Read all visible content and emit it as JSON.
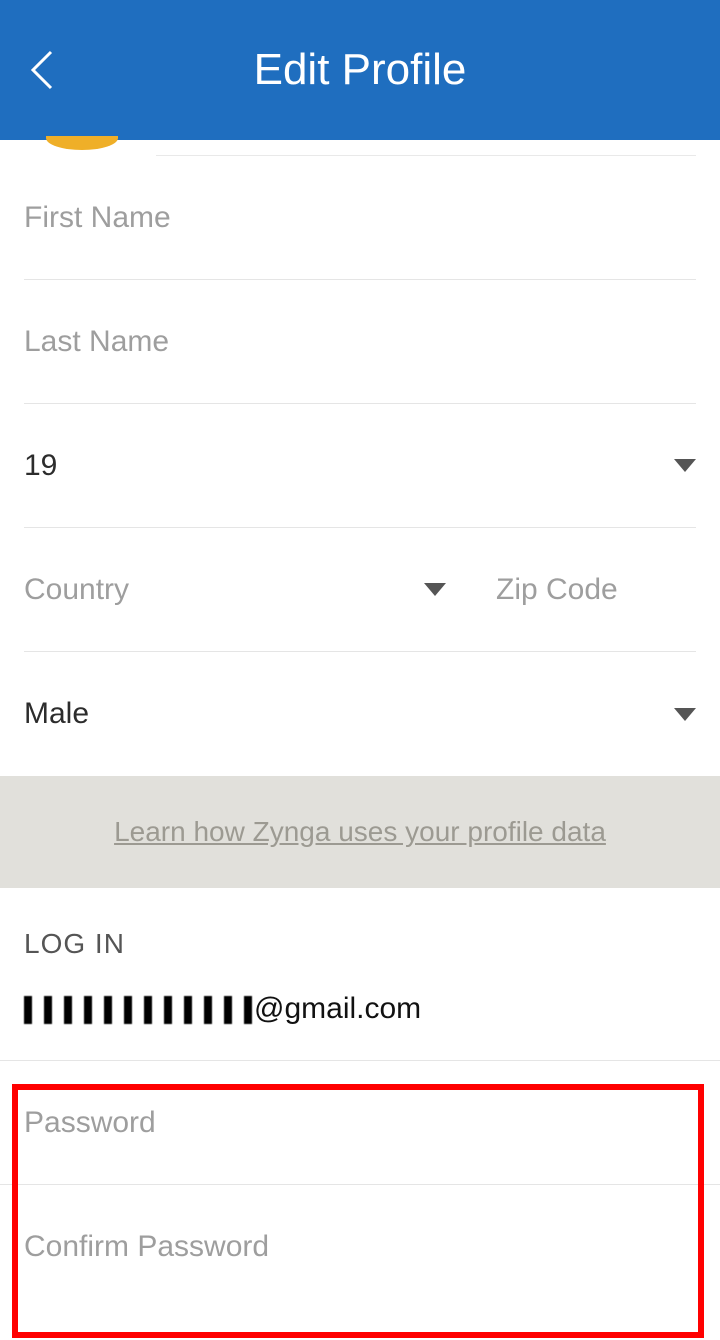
{
  "header": {
    "title": "Edit Profile"
  },
  "profile_form": {
    "first_name_placeholder": "First Name",
    "last_name_placeholder": "Last Name",
    "age_value": "19",
    "country_placeholder": "Country",
    "zip_placeholder": "Zip Code",
    "gender_value": "Male"
  },
  "info": {
    "link_text": "Learn how Zynga uses your profile data"
  },
  "login": {
    "section_title": "LOG IN",
    "email_suffix": "@gmail.com",
    "password_placeholder": "Password",
    "confirm_password_placeholder": "Confirm Password"
  }
}
